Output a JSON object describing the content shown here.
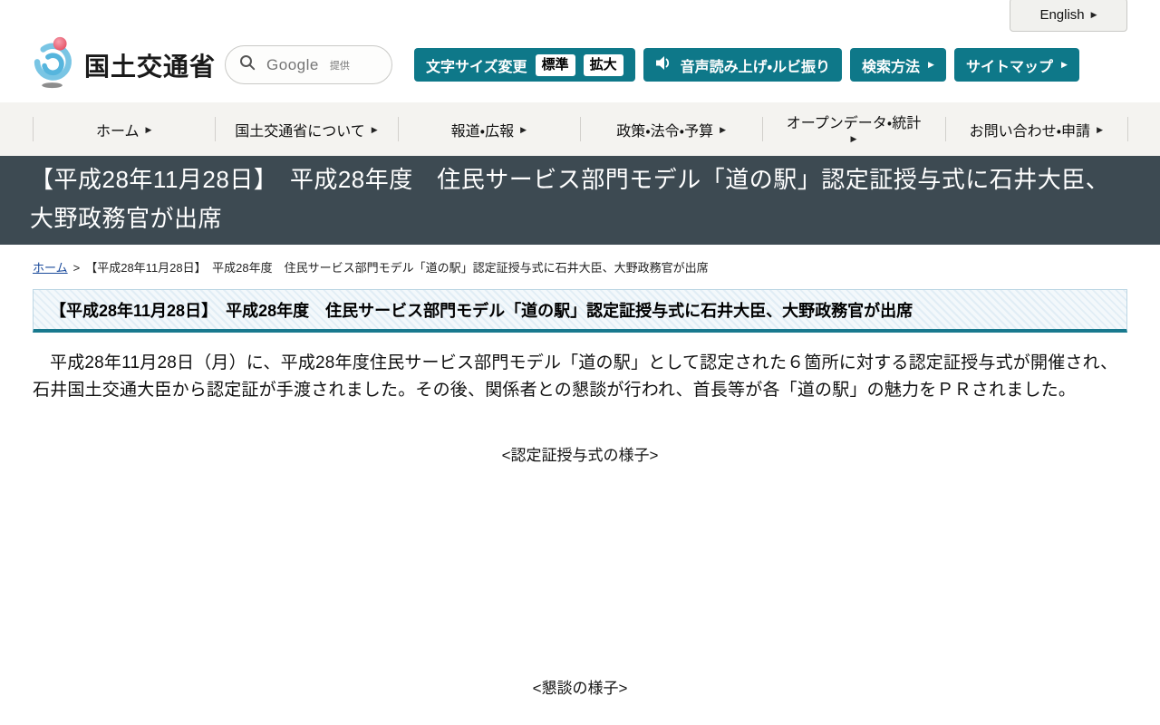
{
  "colors": {
    "teal": "#0e7889",
    "banner_bg": "#3d4a52",
    "nav_bg": "#f4f3f0",
    "link": "#1a4a9b"
  },
  "icons": {
    "arrow_right": "▶",
    "breadcrumb_separator": ">"
  },
  "header": {
    "english_label": "English",
    "logo_text": "国土交通省",
    "search": {
      "provider": "Google",
      "provider_note": "提供"
    },
    "fontsize": {
      "label": "文字サイズ変更",
      "standard": "標準",
      "large": "拡大"
    },
    "speech_label": "音声読み上げ・ルビ振り",
    "search_method_label": "検索方法",
    "sitemap_label": "サイトマップ"
  },
  "nav": {
    "items": [
      {
        "label": "ホーム"
      },
      {
        "label": "国土交通省について"
      },
      {
        "label": "報道・広報"
      },
      {
        "label": "政策・法令・予算"
      },
      {
        "label": "オープンデータ・統計"
      },
      {
        "label": "お問い合わせ・申請"
      }
    ]
  },
  "page": {
    "banner_title": "【平成28年11月28日】　平成28年度　住民サービス部門モデル「道の駅」認定証授与式に石井大臣、大野政務官が出席",
    "breadcrumb": {
      "home": "ホーム",
      "current": "【平成28年11月28日】　平成28年度　住民サービス部門モデル「道の駅」認定証授与式に石井大臣、大野政務官が出席"
    },
    "heading": "【平成28年11月28日】　平成28年度　住民サービス部門モデル「道の駅」認定証授与式に石井大臣、大野政務官が出席",
    "body_paragraph": "平成28年11月28日（月）に、平成28年度住民サービス部門モデル「道の駅」として認定された６箇所に対する認定証授与式が開催され、石井国土交通大臣から認定証が手渡されました。その後、関係者との懇談が行われ、首長等が各「道の駅」の魅力をＰＲされました。",
    "caption_ceremony": "<認定証授与式の様子>",
    "caption_meeting": "<懇談の様子>"
  }
}
